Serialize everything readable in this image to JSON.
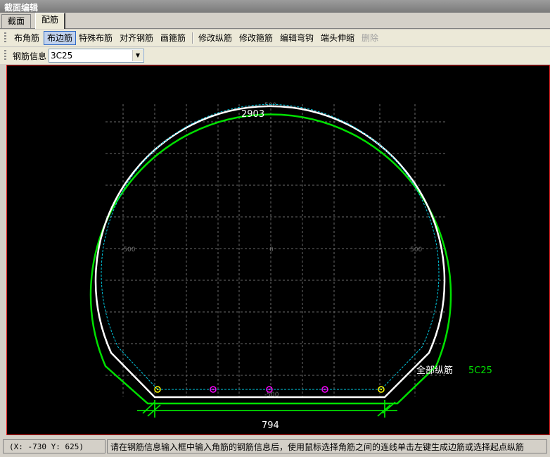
{
  "window": {
    "title": "截面编辑"
  },
  "tabs": [
    {
      "label": "截面"
    },
    {
      "label": "配筋"
    }
  ],
  "toolbar": {
    "items": [
      {
        "label": "布角筋"
      },
      {
        "label": "布边筋"
      },
      {
        "label": "特殊布筋"
      },
      {
        "label": "对齐钢筋"
      },
      {
        "label": "画箍筋"
      },
      {
        "label": "修改纵筋"
      },
      {
        "label": "修改箍筋"
      },
      {
        "label": "编辑弯钩"
      },
      {
        "label": "端头伸缩"
      },
      {
        "label": "删除"
      }
    ]
  },
  "rebar_info": {
    "label": "钢筋信息",
    "value": "3C25"
  },
  "drawing": {
    "top_dimension": "2903",
    "bottom_dimension": "794",
    "axis_labels": {
      "left": "-500",
      "center": "0",
      "right": "500",
      "bottom": "-500",
      "top": "500"
    },
    "rebar_label_prefix": "全部纵筋",
    "rebar_label_value": "5C25",
    "colors": {
      "outline": "#00e000",
      "section": "#ffffff",
      "cover": "#00c8e0",
      "grid": "#6a6a6a",
      "corner_bar": "#ffff00",
      "edge_bar": "#ff00ff"
    }
  },
  "status": {
    "coords": "(X: -730 Y: 625)",
    "message": "请在钢筋信息输入框中输入角筋的钢筋信息后，使用鼠标选择角筋之间的连线单击左键生成边筋或选择起点纵筋"
  }
}
